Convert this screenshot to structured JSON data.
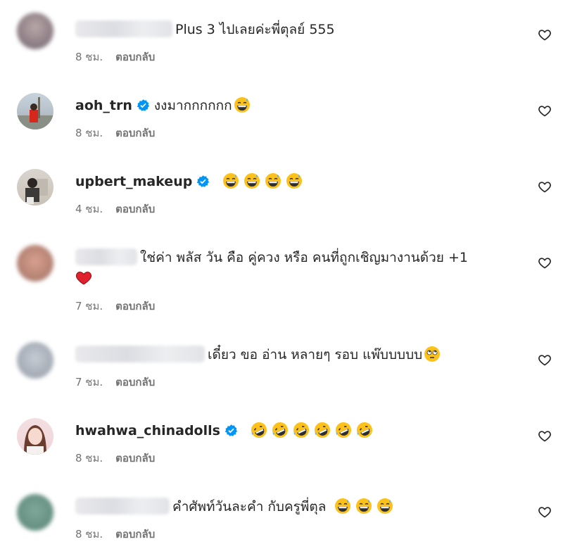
{
  "comments": [
    {
      "username": "",
      "text": "Plus 3 ไปเลยค่ะพี่ตุลย์ 555",
      "time": "8 ชม.",
      "reply": "ตอบกลับ",
      "blurred": true
    },
    {
      "username": "aoh_trn",
      "verified": true,
      "text": "งงมากกกกกก",
      "time": "8 ชม.",
      "reply": "ตอบกลับ"
    },
    {
      "username": "upbert_makeup",
      "verified": true,
      "text": "",
      "time": "4 ชม.",
      "reply": "ตอบกลับ"
    },
    {
      "username": "",
      "text": "ใช่ค่า พลัส วัน คือ คู่ควง หรือ คนที่ถูกเชิญมางานด้วย +1",
      "time": "7 ชม.",
      "reply": "ตอบกลับ",
      "blurred": true
    },
    {
      "username": "",
      "text": "เดี๋ยว ขอ อ่าน หลายๆ รอบ แพ๊บบบบบ",
      "time": "7 ชม.",
      "reply": "ตอบกลับ",
      "blurred": true
    },
    {
      "username": "hwahwa_chinadolls",
      "verified": true,
      "text": "",
      "time": "8 ชม.",
      "reply": "ตอบกลับ"
    },
    {
      "username": "",
      "text": "คำศัพท์วันละคำ กับครูพี่ตุล",
      "time": "8 ชม.",
      "reply": "ตอบกลับ",
      "blurred": true
    }
  ],
  "icons": {
    "like": "heart-outline-icon",
    "verified": "verified-badge-icon"
  },
  "colors": {
    "verified": "#0095f6",
    "text": "#262626",
    "meta": "#737373"
  }
}
